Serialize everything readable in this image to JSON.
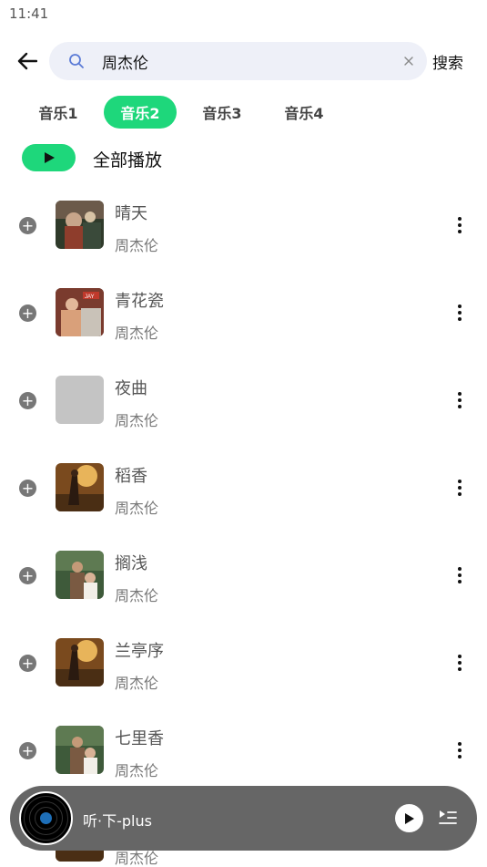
{
  "status_bar": {
    "time": "11:41"
  },
  "search": {
    "value": "周杰伦",
    "button_label": "搜索"
  },
  "tabs": [
    {
      "label": "音乐1",
      "active": false
    },
    {
      "label": "音乐2",
      "active": true
    },
    {
      "label": "音乐3",
      "active": false
    },
    {
      "label": "音乐4",
      "active": false
    }
  ],
  "play_all": {
    "label": "全部播放"
  },
  "songs": [
    {
      "title": "晴天",
      "artist": "周杰伦",
      "cover": "album-cover-1"
    },
    {
      "title": "青花瓷",
      "artist": "周杰伦",
      "cover": "album-cover-2"
    },
    {
      "title": "夜曲",
      "artist": "周杰伦",
      "cover": "placeholder-cover"
    },
    {
      "title": "稻香",
      "artist": "周杰伦",
      "cover": "album-cover-3"
    },
    {
      "title": "搁浅",
      "artist": "周杰伦",
      "cover": "album-cover-4"
    },
    {
      "title": "兰亭序",
      "artist": "周杰伦",
      "cover": "album-cover-3"
    },
    {
      "title": "七里香",
      "artist": "周杰伦",
      "cover": "album-cover-4"
    },
    {
      "title": "",
      "artist": "周杰伦",
      "cover": "album-cover-3"
    }
  ],
  "player": {
    "title": "听·下-plus"
  },
  "colors": {
    "accent": "#1ed77b",
    "player_bg": "#666666",
    "search_bg": "#eef0f8"
  }
}
